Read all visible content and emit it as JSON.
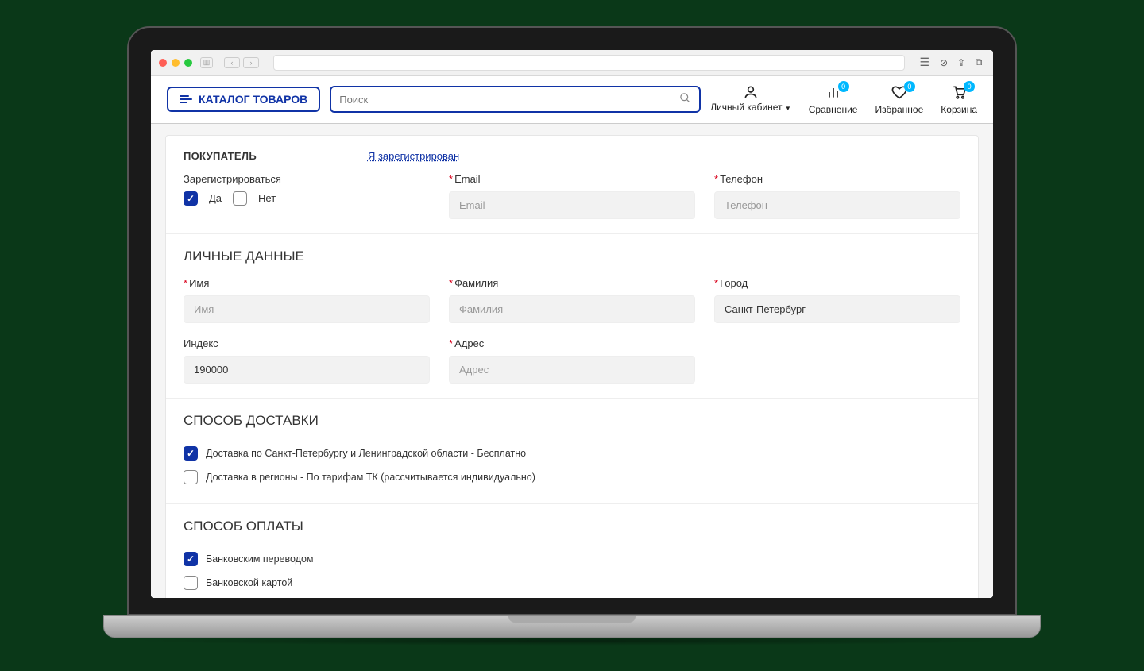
{
  "header": {
    "catalog_label": "КАТАЛОГ ТОВАРОВ",
    "search_placeholder": "Поиск",
    "account_label": "Личный кабинет",
    "compare_label": "Сравнение",
    "compare_badge": "0",
    "favorites_label": "Избранное",
    "favorites_badge": "0",
    "cart_label": "Корзина",
    "cart_badge": "0"
  },
  "buyer": {
    "title": "ПОКУПАТЕЛЬ",
    "login_link": "Я зарегистрирован",
    "register_label": "Зарегистрироваться",
    "yes_label": "Да",
    "no_label": "Нет",
    "email_label": "Email",
    "email_placeholder": "Email",
    "phone_label": "Телефон",
    "phone_placeholder": "Телефон"
  },
  "personal": {
    "title": "ЛИЧНЫЕ ДАННЫЕ",
    "name_label": "Имя",
    "name_placeholder": "Имя",
    "surname_label": "Фамилия",
    "surname_placeholder": "Фамилия",
    "city_label": "Город",
    "city_value": "Санкт-Петербург",
    "zip_label": "Индекс",
    "zip_value": "190000",
    "address_label": "Адрес",
    "address_placeholder": "Адрес"
  },
  "delivery": {
    "title": "СПОСОБ ДОСТАВКИ",
    "opt1": "Доставка по Санкт-Петербургу и Ленинградской области - Бесплатно",
    "opt2": "Доставка в регионы - По тарифам ТК (рассчитывается индивидуально)"
  },
  "payment": {
    "title": "СПОСОБ ОПЛАТЫ",
    "opt1": "Банковским переводом",
    "opt2": "Банковской картой"
  }
}
